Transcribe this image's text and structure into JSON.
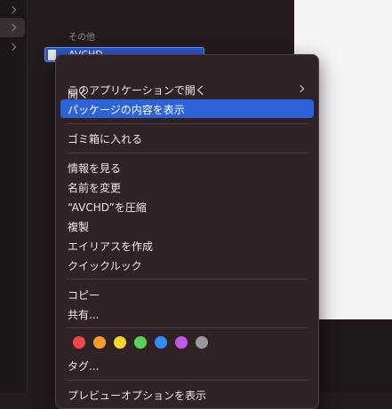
{
  "sidebar": {
    "rows": [
      {
        "name": "sidebar-row-1",
        "selected": false
      },
      {
        "name": "sidebar-row-2",
        "selected": true
      },
      {
        "name": "sidebar-row-3",
        "selected": false
      }
    ]
  },
  "pane": {
    "section_label": "その他",
    "selected_item": "AVCHD"
  },
  "menu": {
    "open": "開く",
    "open_with": "このアプリケーションで開く",
    "show_package_contents": "パッケージの内容を表示",
    "move_to_trash": "ゴミ箱に入れる",
    "get_info": "情報を見る",
    "rename": "名前を変更",
    "compress": "“AVCHD”を圧縮",
    "duplicate": "複製",
    "make_alias": "エイリアスを作成",
    "quick_look": "クイックルック",
    "copy": "コピー",
    "share": "共有...",
    "tags_label": "タグ...",
    "partial_next": "プレビューオプションを表示"
  },
  "tag_colors": [
    "#f0484a",
    "#f59d2a",
    "#f5d42c",
    "#5ad25a",
    "#2e8ef5",
    "#c05be3",
    "#9a9a9e"
  ]
}
